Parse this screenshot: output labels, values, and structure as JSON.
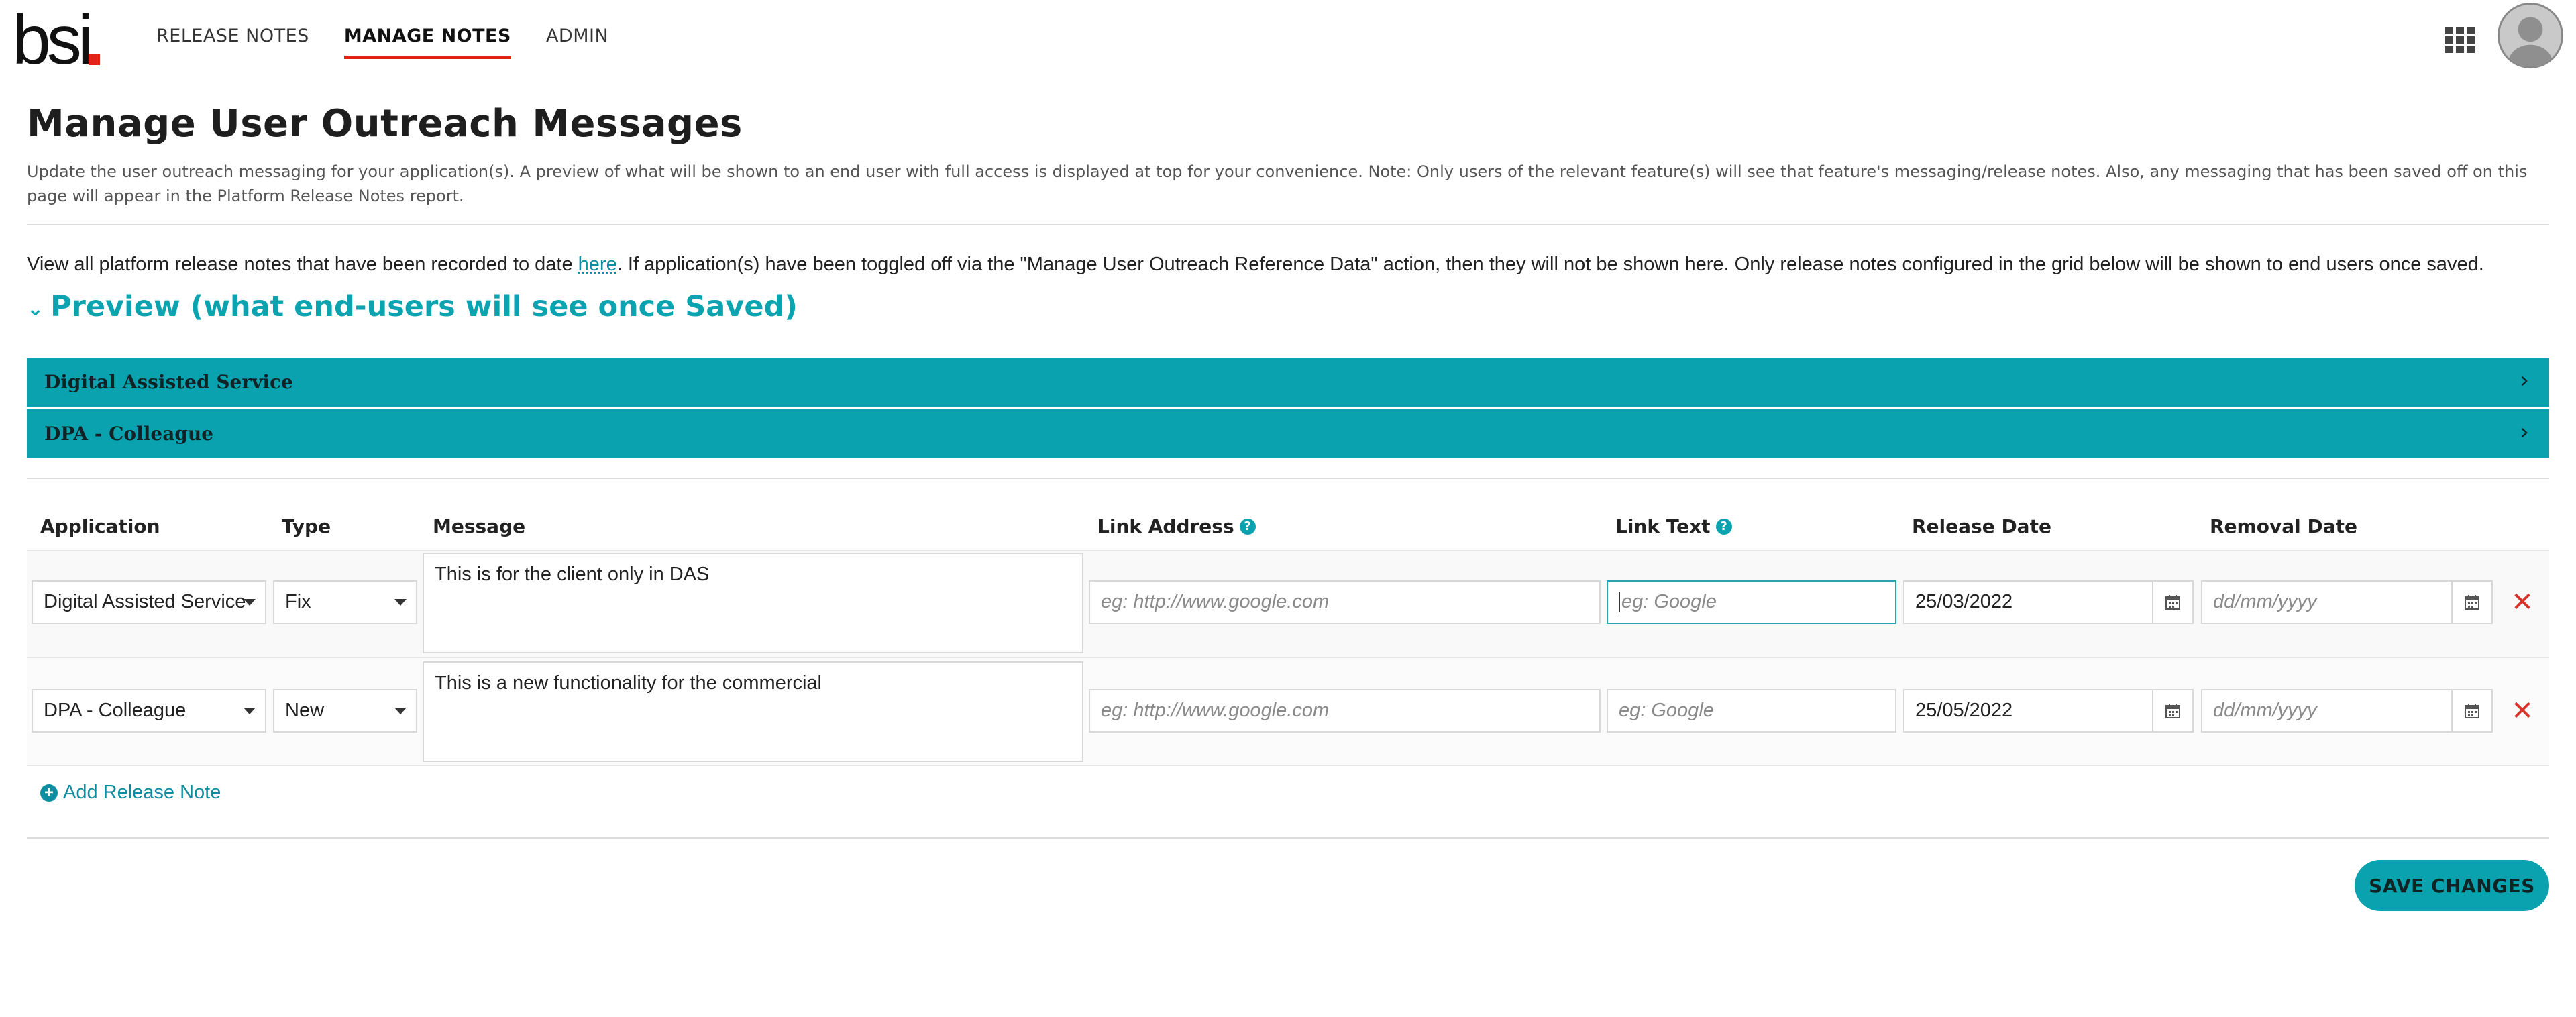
{
  "brand": {
    "logo_text": "bsi",
    "dot_color": "#e2231a"
  },
  "nav": {
    "items": [
      {
        "label": "RELEASE NOTES",
        "active": false
      },
      {
        "label": "MANAGE NOTES",
        "active": true
      },
      {
        "label": "ADMIN",
        "active": false
      }
    ]
  },
  "page": {
    "title": "Manage User Outreach Messages",
    "description": "Update the user outreach messaging for your application(s). A preview of what will be shown to an end user with full access is displayed at top for your convenience. Note: Only users of the relevant feature(s) will see that feature's messaging/release notes. Also, any messaging that has been saved off on this page will appear in the Platform Release Notes report.",
    "view_all_before": "View all platform release notes that have been recorded to date ",
    "view_all_link": "here",
    "view_all_after": ". If application(s) have been toggled off via the \"Manage User Outreach Reference Data\" action, then they will not be shown here. Only release notes configured in the grid below will be shown to end users once saved."
  },
  "preview": {
    "title": "Preview (what end-users will see once Saved)",
    "panels": [
      {
        "label": "Digital Assisted Service"
      },
      {
        "label": "DPA - Colleague"
      }
    ]
  },
  "grid": {
    "headers": {
      "application": "Application",
      "type": "Type",
      "message": "Message",
      "link_address": "Link Address",
      "link_text": "Link Text",
      "release_date": "Release Date",
      "removal_date": "Removal Date"
    },
    "placeholders": {
      "link_address": "eg: http://www.google.com",
      "link_text": "eg: Google",
      "removal_date": "dd/mm/yyyy"
    },
    "rows": [
      {
        "application": "Digital Assisted Service",
        "type": "Fix",
        "message": "This is for the client only in DAS",
        "release_date": "25/03/2022"
      },
      {
        "application": "DPA - Colleague",
        "type": "New",
        "message": "This is a new functionality for the commercial",
        "release_date": "25/05/2022"
      }
    ],
    "add_label": "Add Release Note"
  },
  "actions": {
    "save_label": "SAVE CHANGES"
  },
  "colors": {
    "accent": "#0aa2ae",
    "link": "#0d8ea0",
    "danger": "#d6332b"
  }
}
